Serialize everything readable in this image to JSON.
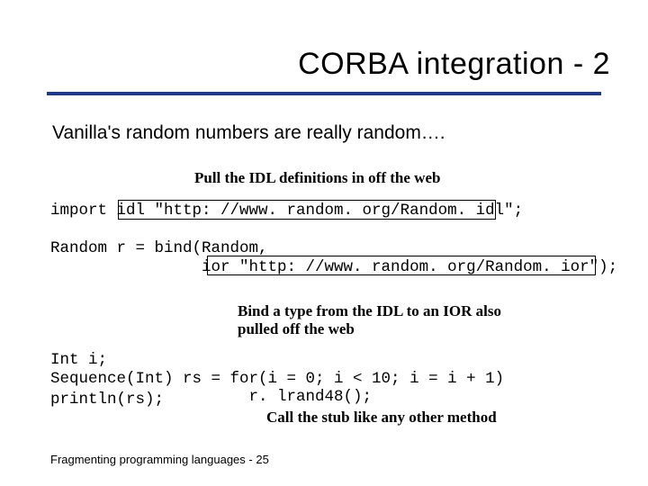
{
  "title": "CORBA integration - 2",
  "intro": "Vanilla's random numbers are really random….",
  "captions": {
    "pull": "Pull the IDL definitions in off the web",
    "bind": "Bind a type from the IDL to an IOR also pulled off the web",
    "call": "Call the stub like any other method"
  },
  "code": {
    "import": "import idl \"http: //www. random. org/Random. idl\";",
    "bind": "Random r = bind(Random,\n                ior \"http: //www. random. org/Random. ior\");",
    "loop": "Int i;\nSequence(Int) rs = for(i = 0; i < 10; i = i + 1)\n                     r. lrand48();",
    "print": "println(rs);"
  },
  "footer": "Fragmenting programming languages  - 25"
}
